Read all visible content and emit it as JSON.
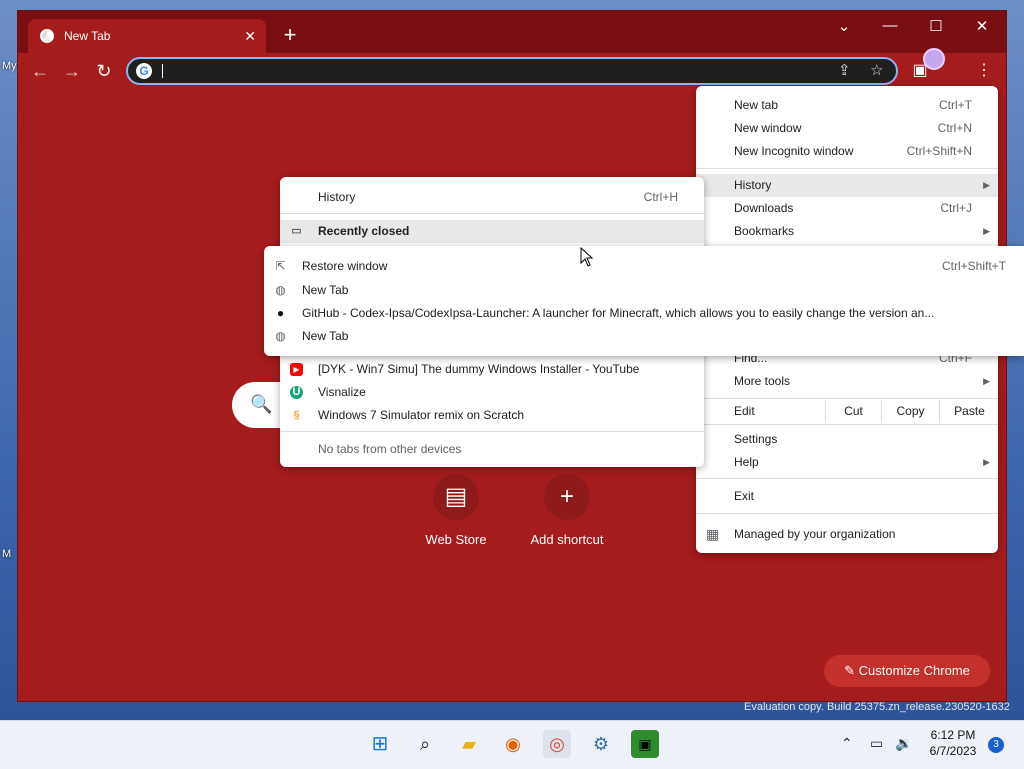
{
  "desktop": {
    "icon_labels": [
      "My",
      "M"
    ]
  },
  "tab": {
    "title": "New Tab"
  },
  "window_controls": {
    "minimize": "—",
    "maximize": "☐",
    "close": "✕",
    "chevron": "⌄"
  },
  "ntp": {
    "shortcuts": [
      {
        "label": "Web Store"
      },
      {
        "label": "Add shortcut"
      }
    ],
    "customize_label": "Customize Chrome"
  },
  "main_menu": {
    "items_top": [
      {
        "label": "New tab",
        "shortcut": "Ctrl+T"
      },
      {
        "label": "New window",
        "shortcut": "Ctrl+N"
      },
      {
        "label": "New Incognito window",
        "shortcut": "Ctrl+Shift+N"
      }
    ],
    "items_mid": [
      {
        "label": "History"
      },
      {
        "label": "Downloads",
        "shortcut": "Ctrl+J"
      },
      {
        "label": "Bookmarks"
      }
    ],
    "find": {
      "label": "Find...",
      "shortcut": "Ctrl+F"
    },
    "more_tools": "More tools",
    "edit": {
      "label": "Edit",
      "cut": "Cut",
      "copy": "Copy",
      "paste": "Paste"
    },
    "settings": "Settings",
    "help": "Help",
    "exit": "Exit",
    "managed": "Managed by your organization"
  },
  "history_menu": {
    "history": {
      "label": "History",
      "shortcut": "Ctrl+H"
    },
    "recently_closed": "Recently closed",
    "items": [
      {
        "label": "[DYK - Win7 Simu] The dummy Windows Installer - YouTube",
        "icon": "youtube-icon",
        "color": "#ff0000"
      },
      {
        "label": "Visnalize",
        "icon": "visnalize-icon",
        "color": "#1aa37a"
      },
      {
        "label": "Windows 7 Simulator remix on Scratch",
        "icon": "scratch-icon",
        "color": "#f0a030"
      }
    ],
    "no_tabs": "No tabs from other devices"
  },
  "recently_closed_menu": {
    "items": [
      {
        "label": "Restore window",
        "shortcut": "Ctrl+Shift+T",
        "icon": "restore-icon"
      },
      {
        "label": "New Tab",
        "icon": "globe-icon"
      },
      {
        "label": "GitHub - Codex-Ipsa/CodexIpsa-Launcher: A launcher for Minecraft, which allows you to easily change the version an...",
        "icon": "github-icon"
      },
      {
        "label": "New Tab",
        "icon": "globe-icon"
      }
    ]
  },
  "taskbar": {
    "time": "6:12 PM",
    "date": "6/7/2023",
    "notifications": "3"
  },
  "watermark": "Evaluation copy. Build 25375.zn_release.230520-1632",
  "colors": {
    "chrome_frame": "#7a0f13",
    "ntp_bg": "#a51c1c",
    "focus_ring": "#8ab4f8"
  }
}
